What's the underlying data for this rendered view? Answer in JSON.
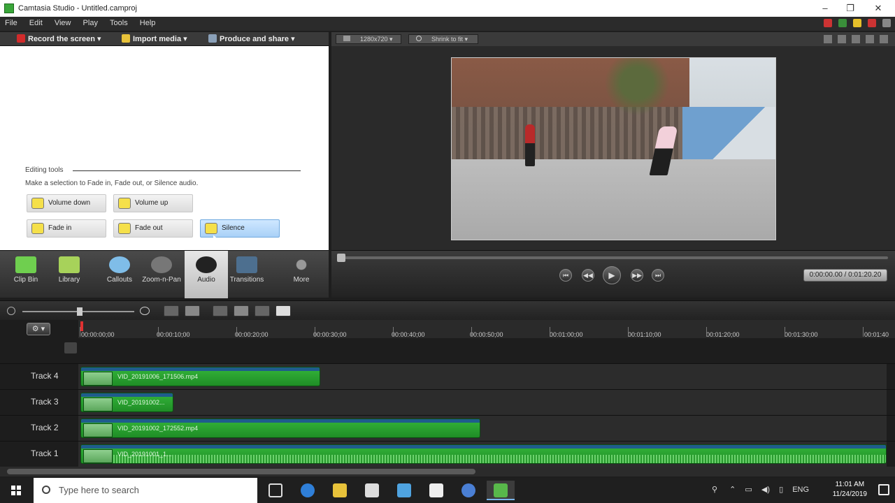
{
  "window": {
    "title": "Camtasia Studio - Untitled.camproj"
  },
  "menu": [
    "File",
    "Edit",
    "View",
    "Play",
    "Tools",
    "Help"
  ],
  "toolbar": {
    "record": "Record the screen",
    "import": "Import media",
    "produce": "Produce and share"
  },
  "preview": {
    "size_dropdown": "1280x720",
    "zoom_dropdown": "Shrink to fit"
  },
  "editing_tools": {
    "section_label": "Editing tools",
    "hint": "Make a selection to Fade in, Fade out, or Silence audio.",
    "buttons": [
      {
        "label": "Volume down"
      },
      {
        "label": "Volume up"
      },
      {
        "label": "Fade in"
      },
      {
        "label": "Fade out"
      },
      {
        "label": "Silence"
      }
    ]
  },
  "tasks": [
    "Clip Bin",
    "Library",
    "Callouts",
    "Zoom-n-Pan",
    "Audio",
    "Transitions",
    "More"
  ],
  "playback": {
    "timecode": "0:00:00.00 / 0:01:20.20"
  },
  "timeline": {
    "ruler": [
      "00:00:00;00",
      "00:00:10;00",
      "00:00:20;00",
      "00:00:30;00",
      "00:00:40;00",
      "00:00:50;00",
      "00:01:00;00",
      "00:01:10;00",
      "00:01:20;00",
      "00:01:30;00",
      "00:01:40"
    ],
    "tracks": [
      {
        "label": "Track 4",
        "clip": "VID_20191006_171506.mp4"
      },
      {
        "label": "Track 3",
        "clip": "VID_20191002..."
      },
      {
        "label": "Track 2",
        "clip": "VID_20191002_172552.mp4"
      },
      {
        "label": "Track 1",
        "clip": "VID_20191001_1..."
      }
    ]
  },
  "taskbar": {
    "search_placeholder": "Type here to search",
    "lang": "ENG",
    "time": "11:01 AM",
    "date": "11/24/2019"
  },
  "colors": {
    "clip_green": "#2ea336",
    "clip_header_blue": "#1f5c8c",
    "active_tool": "#a9d1f7"
  }
}
